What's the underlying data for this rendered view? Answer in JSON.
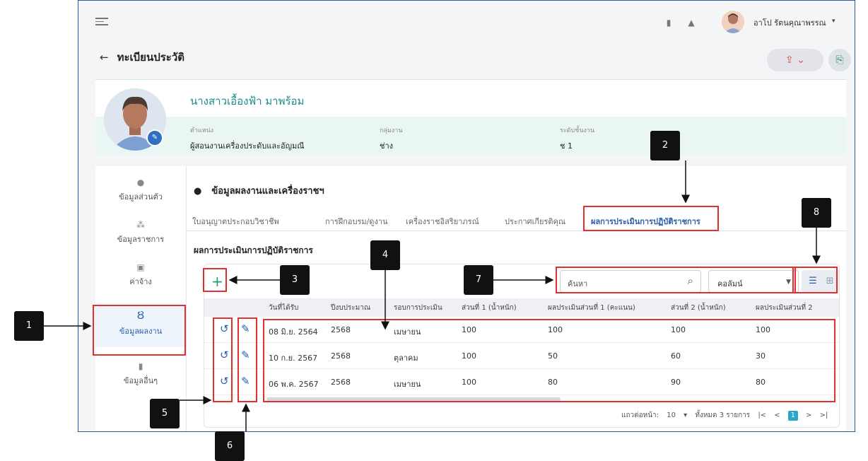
{
  "header": {
    "user_name": "อาโป รัตนคุณาพรรณ",
    "caret": "▾",
    "back_arrow": "←",
    "page_title": "ทะเบียนประวัติ"
  },
  "profile": {
    "full_name": "นางสาวเอื้องฟ้า มาพร้อม",
    "position_label": "ตำแหน่ง",
    "position_value": "ผู้สอนงานเครื่องประดับและอัญมณี",
    "group_label": "กลุ่มงาน",
    "group_value": "ช่าง",
    "level_label": "ระดับชั้นงาน",
    "level_value": "ช 1"
  },
  "sidebar": {
    "items": [
      {
        "label": "ข้อมูลส่วนตัว",
        "icon": "person-icon"
      },
      {
        "label": "ข้อมูลราชการ",
        "icon": "people-icon"
      },
      {
        "label": "ค่าจ้าง",
        "icon": "money-icon"
      },
      {
        "label": "ข้อมูลผลงาน",
        "icon": "medal-icon"
      },
      {
        "label": "ข้อมูลอื่นๆ",
        "icon": "bookmark-icon"
      }
    ]
  },
  "main": {
    "section_title": "ข้อมูลผลงานและเครื่องราชฯ",
    "tabs": [
      {
        "label": "ใบอนุญาตประกอบวิชาชีพ"
      },
      {
        "label": "การฝึกอบรม/ดูงาน"
      },
      {
        "label": "เครื่องราชอิสริยาภรณ์"
      },
      {
        "label": "ประกาศเกียรติคุณ"
      },
      {
        "label": "ผลการประเมินการปฏิบัติราชการ"
      }
    ],
    "table_title": "ผลการประเมินการปฏิบัติราชการ",
    "add_symbol": "+",
    "search_placeholder": "ค้นหา",
    "column_select": "คอลัมน์",
    "columns": [
      "วันที่ได้รับ",
      "ปีงบประมาณ",
      "รอบการประเมิน",
      "ส่วนที่ 1 (น้ำหนัก)",
      "ผลประเมินส่วนที่ 1 (คะแนน)",
      "ส่วนที่ 2 (น้ำหนัก)",
      "ผลประเมินส่วนที่ 2"
    ],
    "rows": [
      [
        "08 มิ.ย. 2564",
        "2568",
        "เมษายน",
        "100",
        "100",
        "100",
        "100"
      ],
      [
        "10 ก.ย. 2567",
        "2568",
        "ตุลาคม",
        "100",
        "50",
        "60",
        "30"
      ],
      [
        "06 พ.ค. 2567",
        "2568",
        "เมษายน",
        "100",
        "80",
        "90",
        "80"
      ]
    ],
    "pager": {
      "rows_per_page_label": "แถวต่อหน้า:",
      "rows_per_page": "10",
      "total": "ทั้งหมด 3 รายการ",
      "first": "|<",
      "prev": "<",
      "page": "1",
      "next": ">",
      "last": ">|"
    }
  },
  "callouts": [
    "1",
    "2",
    "3",
    "4",
    "5",
    "6",
    "7",
    "8"
  ],
  "colors": {
    "accent": "#2a5ea8",
    "teal": "#1c8a8a",
    "annotation_red": "#e03030",
    "callout_bg": "#111111"
  }
}
